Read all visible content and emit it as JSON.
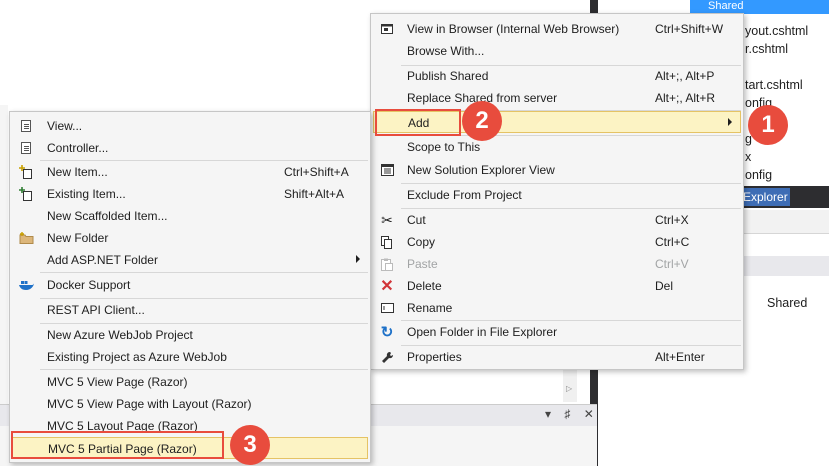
{
  "solution_explorer": {
    "tree_top": "Shared",
    "files": [
      "yout.cshtml",
      "r.cshtml",
      "tart.cshtml",
      "onfig",
      "g",
      "x",
      "onfig"
    ],
    "tab_label": "Explorer",
    "property_value": "Shared"
  },
  "output_panel": {
    "controls": "▾ ♯ ✕"
  },
  "left_menu": {
    "items": [
      {
        "label": "View...",
        "shortcut": "",
        "icon": "view-icon"
      },
      {
        "label": "Controller...",
        "shortcut": "",
        "icon": "controller-icon"
      },
      {
        "label": "New Item...",
        "shortcut": "Ctrl+Shift+A",
        "icon": "new-item-icon"
      },
      {
        "label": "Existing Item...",
        "shortcut": "Shift+Alt+A",
        "icon": "existing-item-icon"
      },
      {
        "label": "New Scaffolded Item...",
        "shortcut": "",
        "icon": ""
      },
      {
        "label": "New Folder",
        "shortcut": "",
        "icon": "new-folder-icon"
      },
      {
        "label": "Add ASP.NET Folder",
        "shortcut": "",
        "icon": "",
        "submenu": true
      },
      {
        "label": "Docker Support",
        "shortcut": "",
        "icon": "docker-icon"
      },
      {
        "label": "REST API Client...",
        "shortcut": "",
        "icon": ""
      },
      {
        "label": "New Azure WebJob Project",
        "shortcut": "",
        "icon": ""
      },
      {
        "label": "Existing Project as Azure WebJob",
        "shortcut": "",
        "icon": ""
      },
      {
        "label": "MVC 5 View Page (Razor)",
        "shortcut": "",
        "icon": ""
      },
      {
        "label": "MVC 5 View Page with Layout (Razor)",
        "shortcut": "",
        "icon": ""
      },
      {
        "label": "MVC 5 Layout Page (Razor)",
        "shortcut": "",
        "icon": ""
      },
      {
        "label": "MVC 5 Partial Page (Razor)",
        "shortcut": "",
        "icon": "",
        "highlighted": true
      }
    ]
  },
  "right_menu": {
    "items": [
      {
        "label": "View in Browser (Internal Web Browser)",
        "shortcut": "Ctrl+Shift+W",
        "icon": "browser-icon"
      },
      {
        "label": "Browse With...",
        "shortcut": "",
        "icon": ""
      },
      {
        "label": "Publish Shared",
        "shortcut": "Alt+;, Alt+P",
        "icon": ""
      },
      {
        "label": "Replace Shared from server",
        "shortcut": "Alt+;, Alt+R",
        "icon": ""
      },
      {
        "label": "Add",
        "shortcut": "",
        "icon": "",
        "submenu": true,
        "highlighted": true
      },
      {
        "label": "Scope to This",
        "shortcut": "",
        "icon": ""
      },
      {
        "label": "New Solution Explorer View",
        "shortcut": "",
        "icon": "solution-view-icon"
      },
      {
        "label": "Exclude From Project",
        "shortcut": "",
        "icon": ""
      },
      {
        "label": "Cut",
        "shortcut": "Ctrl+X",
        "icon": "scissors-icon"
      },
      {
        "label": "Copy",
        "shortcut": "Ctrl+C",
        "icon": "copy-icon"
      },
      {
        "label": "Paste",
        "shortcut": "Ctrl+V",
        "icon": "paste-icon",
        "disabled": true
      },
      {
        "label": "Delete",
        "shortcut": "Del",
        "icon": "delete-icon"
      },
      {
        "label": "Rename",
        "shortcut": "",
        "icon": "rename-icon"
      },
      {
        "label": "Open Folder in File Explorer",
        "shortcut": "",
        "icon": "open-folder-icon"
      },
      {
        "label": "Properties",
        "shortcut": "Alt+Enter",
        "icon": "wrench-icon"
      }
    ]
  },
  "callouts": {
    "badge1": "1",
    "badge2": "2",
    "badge3": "3",
    "color": "#e84c3d"
  },
  "colors": {
    "highlight_bg": "#fcf3c4",
    "highlight_border": "#e5c365",
    "selection_blue": "#3399ff",
    "dark_chrome": "#2d2d30"
  }
}
